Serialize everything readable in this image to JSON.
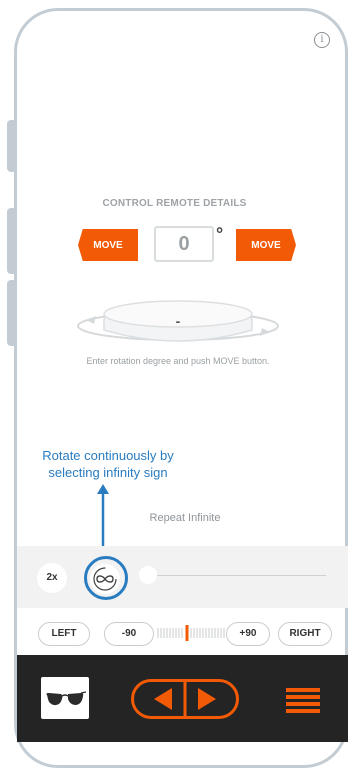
{
  "header": {
    "info_icon": "info-circle-icon"
  },
  "control": {
    "title": "CONTROL REMOTE DETAILS",
    "move_left_label": "MOVE",
    "move_right_label": "MOVE",
    "degree_value": "0",
    "degree_symbol": "°",
    "platform_value": "-",
    "hint": "Enter rotation degree and push MOVE button."
  },
  "callout": {
    "line1": "Rotate continuously by",
    "line2": "selecting infinity sign"
  },
  "repeat_label": "Repeat Infinite",
  "speed": {
    "label": "2x"
  },
  "rotation": {
    "left_label": "LEFT",
    "minus_label": "-90",
    "plus_label": "+90",
    "right_label": "RIGHT"
  },
  "colors": {
    "accent": "#f25a05",
    "callout": "#2a7cc0",
    "bar": "#242424"
  },
  "icons": {
    "infinity": "infinity-rotate-icon",
    "glasses": "sunglasses-thumbnail",
    "play_prev": "triangle-left-icon",
    "play_next": "triangle-right-icon",
    "menu": "hamburger-menu-icon"
  }
}
